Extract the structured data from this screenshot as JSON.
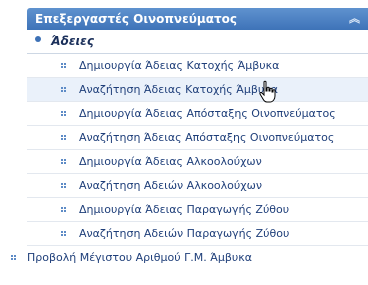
{
  "menu": {
    "header": "Επεξεργαστές Οινοπνεύματος",
    "section": "Άδειες",
    "items": [
      "Δημιουργία Άδειας Κατοχής Άμβυκα",
      "Αναζήτηση Άδειας Κατοχής Άμβυκα",
      "Δημιουργία Άδειας Απόσταξης Οινοπνεύματος",
      "Αναζήτηση Άδειας Απόσταξης Οινοπνεύματος",
      "Δημιουργία Άδειας Αλκοολούχων",
      "Αναζήτηση Αδειών Αλκοολούχων",
      "Δημιουργία Άδειας Παραγωγής Ζύθου",
      "Αναζήτηση Αδειών Παραγωγής Ζύθου"
    ],
    "bottom_item": "Προβολή Μέγιστου Αριθμού Γ.Μ. Άμβυκα"
  },
  "icons": {
    "collapse": "double-chevron-up-icon",
    "section_bullet": "bullet-dot-icon",
    "item_bullet": "dotted-square-icon",
    "cursor": "hand-pointer-icon"
  },
  "colors": {
    "header_bg": "#4a7fc1",
    "text": "#1f3f7a",
    "hover_bg": "#eaf1fa"
  }
}
